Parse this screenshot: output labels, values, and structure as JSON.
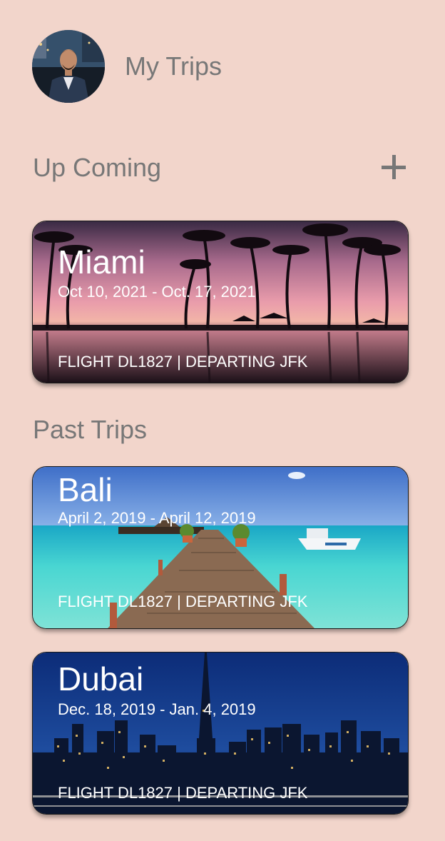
{
  "header": {
    "title": "My Trips",
    "avatar_icon": "user-avatar"
  },
  "upcoming": {
    "title": "Up Coming",
    "add_icon": "plus-icon",
    "trips": [
      {
        "city": "Miami",
        "dates": "Oct 10, 2021 - Oct. 17, 2021",
        "flight": "FLIGHT DL1827 | DEPARTING JFK"
      }
    ]
  },
  "past": {
    "title": "Past Trips",
    "trips": [
      {
        "city": "Bali",
        "dates": "April 2, 2019 - April 12, 2019",
        "flight": "FLIGHT DL1827 | DEPARTING JFK"
      },
      {
        "city": "Dubai",
        "dates": "Dec. 18, 2019 - Jan. 4, 2019",
        "flight": "FLIGHT DL1827 | DEPARTING JFK"
      }
    ]
  },
  "colors": {
    "background": "#f2d5cb",
    "muted_text": "#777777",
    "card_text": "#ffffff"
  }
}
